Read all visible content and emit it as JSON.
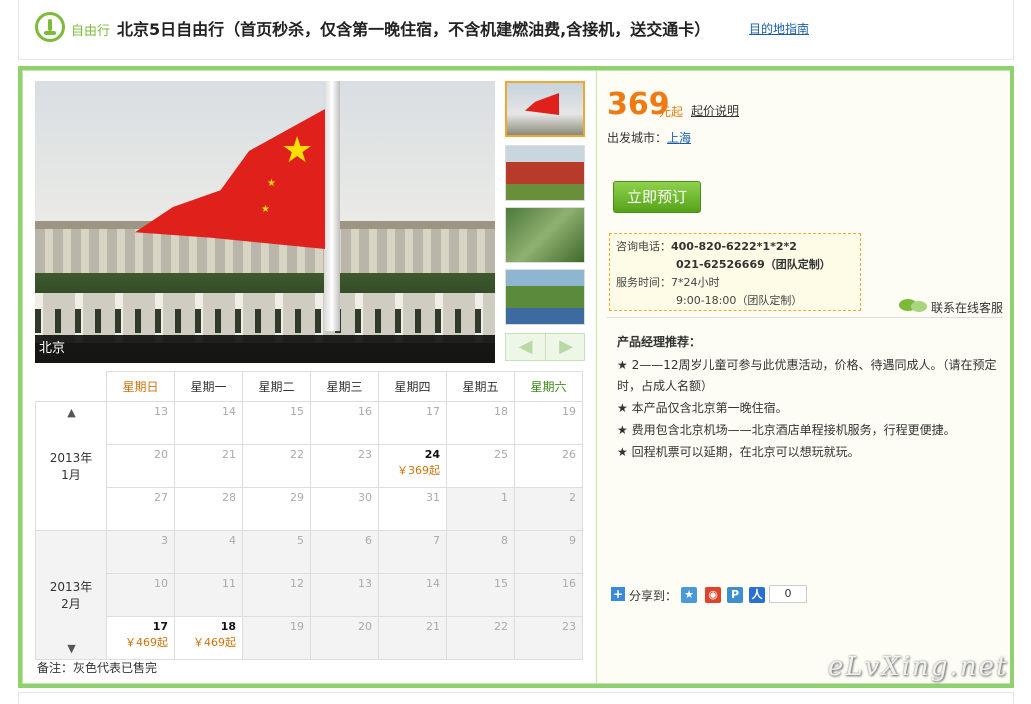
{
  "header": {
    "tag": "自由行",
    "title": "北京5日自由行（首页秒杀，仅含第一晚住宿，不含机建燃油费,含接机，送交通卡）",
    "guide_link": "目的地指南"
  },
  "gallery": {
    "caption": "北京",
    "thumbnails": [
      "升旗",
      "天安门",
      "长城",
      "颐和园"
    ],
    "prev": "◀",
    "next": "▶"
  },
  "calendar": {
    "weekdays": [
      "星期日",
      "星期一",
      "星期二",
      "星期三",
      "星期四",
      "星期五",
      "星期六"
    ],
    "up_arrow": "▲",
    "down_arrow": "▼",
    "months": [
      {
        "label_year": "2013年",
        "label_month": "1月",
        "weeks": [
          [
            {
              "d": "13"
            },
            {
              "d": "14"
            },
            {
              "d": "15"
            },
            {
              "d": "16"
            },
            {
              "d": "17"
            },
            {
              "d": "18"
            },
            {
              "d": "19"
            }
          ],
          [
            {
              "d": "20"
            },
            {
              "d": "21"
            },
            {
              "d": "22"
            },
            {
              "d": "23"
            },
            {
              "d": "24",
              "price": "￥369起"
            },
            {
              "d": "25"
            },
            {
              "d": "26"
            }
          ],
          [
            {
              "d": "27"
            },
            {
              "d": "28"
            },
            {
              "d": "29"
            },
            {
              "d": "30"
            },
            {
              "d": "31"
            },
            {
              "d": "1",
              "grey": true
            },
            {
              "d": "2",
              "grey": true
            }
          ]
        ]
      },
      {
        "label_year": "2013年",
        "label_month": "2月",
        "weeks": [
          [
            {
              "d": "3"
            },
            {
              "d": "4"
            },
            {
              "d": "5"
            },
            {
              "d": "6"
            },
            {
              "d": "7"
            },
            {
              "d": "8"
            },
            {
              "d": "9"
            }
          ],
          [
            {
              "d": "10"
            },
            {
              "d": "11"
            },
            {
              "d": "12"
            },
            {
              "d": "13"
            },
            {
              "d": "14"
            },
            {
              "d": "15"
            },
            {
              "d": "16"
            }
          ],
          [
            {
              "d": "17",
              "price": "￥469起"
            },
            {
              "d": "18",
              "price": "￥469起"
            },
            {
              "d": "19"
            },
            {
              "d": "20"
            },
            {
              "d": "21"
            },
            {
              "d": "22"
            },
            {
              "d": "23"
            }
          ]
        ]
      }
    ],
    "note": "备注：灰色代表已售完"
  },
  "pricing": {
    "price": "369",
    "unit": "元起",
    "explain": "起价说明",
    "depart_label": "出发城市：",
    "depart_city": "上海",
    "book_button": "立即预订"
  },
  "contact": {
    "phone_label": "咨询电话：",
    "phone1": "400-820-6222*1*2*2",
    "phone2": "021-62526669（团队定制）",
    "hours_label": "服务时间：",
    "hours1": "7*24小时",
    "hours2": "9:00-18:00（团队定制）",
    "chat_link": "联系在线客服"
  },
  "recommend": {
    "title": "产品经理推荐：",
    "items": [
      "★ 2——12周岁儿童可参与此优惠活动，价格、待遇同成人。（请在预定时，占成人名额）",
      "★ 本产品仅含北京第一晚住宿。",
      "★ 费用包含北京机场——北京酒店单程接机服务，行程更便捷。",
      "★ 回程机票可以延期，在北京可以想玩就玩。"
    ]
  },
  "share": {
    "label": "分享到：",
    "icons": [
      "qzone-icon",
      "weibo-icon",
      "tencent-icon",
      "renren-icon"
    ],
    "count": "0"
  },
  "watermark": "eLvXing.net"
}
